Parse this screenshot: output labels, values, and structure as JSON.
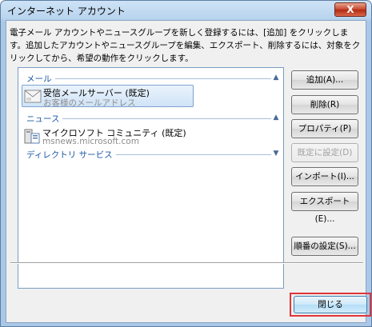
{
  "window": {
    "title": "インターネット アカウント",
    "close_label": "X"
  },
  "description": "電子メール アカウントやニュースグループを新しく登録するには、[追加] をクリックします。追加したアカウントやニュースグループを編集、エクスポート、削除するには、対象をクリックしてから、希望の動作をクリックします。",
  "list": {
    "groups": [
      {
        "label": "メール",
        "items": [
          {
            "name": "受信メールサーバー (既定)",
            "sub": "お客様のメールアドレス",
            "selected": true
          }
        ]
      },
      {
        "label": "ニュース",
        "items": [
          {
            "name": "マイクロソフト コミュニティ (既定)",
            "sub": "msnews.microsoft.com",
            "selected": false
          }
        ]
      },
      {
        "label": "ディレクトリ サービス",
        "items": []
      }
    ]
  },
  "buttons": {
    "add": "追加(A)...",
    "remove": "削除(R)",
    "properties": "プロパティ(P)",
    "set_default": "既定に設定(D)",
    "import": "インポート(I)...",
    "export": "エクスポート(E)...",
    "order": "順番の設定(S)...",
    "close": "閉じる"
  },
  "colors": {
    "group_header": "#1b57a6",
    "highlight_box": "#e0353a",
    "selection": "#cfe3f7"
  }
}
